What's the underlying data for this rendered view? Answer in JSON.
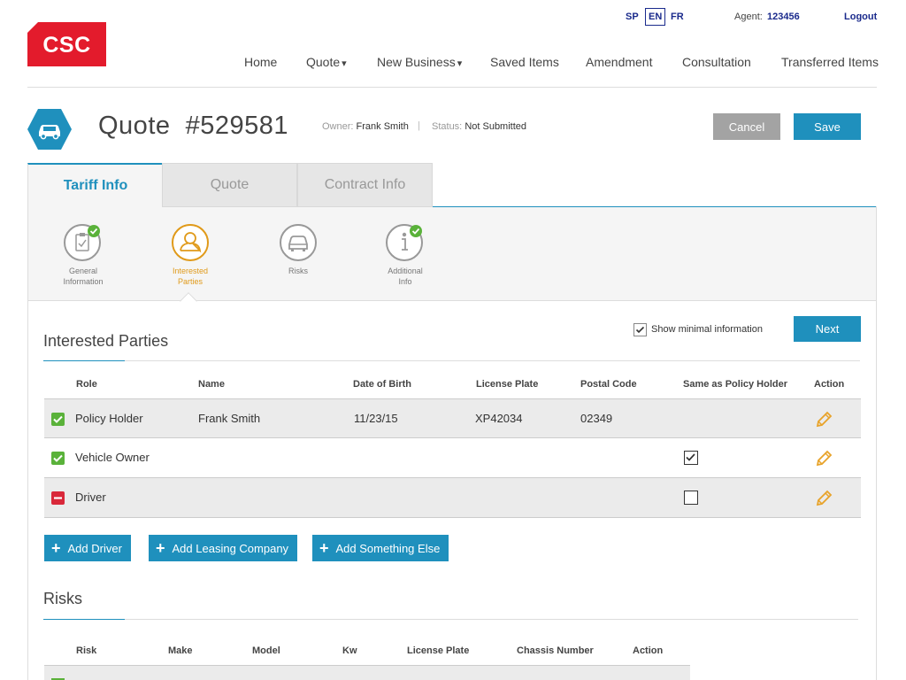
{
  "header": {
    "logo_text": "CSC",
    "languages": [
      "SP",
      "EN",
      "FR"
    ],
    "selected_language": "EN",
    "agent_label": "Agent:",
    "agent_id": "123456",
    "logout": "Logout"
  },
  "nav": {
    "home": "Home",
    "quote": "Quote",
    "new_business": "New Business",
    "saved_items": "Saved Items",
    "amendment": "Amendment",
    "consultation": "Consultation",
    "transferred_items": "Transferred Items",
    "caret": "▾"
  },
  "quote": {
    "title": "Quote",
    "number": "#529581",
    "owner_label": "Owner:",
    "owner": "Frank Smith",
    "separator": "|",
    "status_label": "Status:",
    "status": "Not Submitted",
    "cancel": "Cancel",
    "save": "Save"
  },
  "tabs": [
    {
      "label": "Tariff Info",
      "active": true
    },
    {
      "label": "Quote",
      "active": false
    },
    {
      "label": "Contract Info",
      "active": false
    }
  ],
  "steps": [
    {
      "label_1": "General",
      "label_2": "Information",
      "icon": "clipboard-icon",
      "done": true
    },
    {
      "label_1": "Interested",
      "label_2": "Parties",
      "icon": "person-icon",
      "current": true
    },
    {
      "label_1": "Risks",
      "label_2": "",
      "icon": "car-icon"
    },
    {
      "label_1": "Additional",
      "label_2": "Info",
      "icon": "info-icon",
      "done": true
    }
  ],
  "interested_parties": {
    "title": "Interested Parties",
    "minimal_label": "Show minimal information",
    "minimal_checked": true,
    "next": "Next",
    "columns": [
      "Role",
      "Name",
      "Date of Birth",
      "License Plate",
      "Postal Code",
      "Same as Policy Holder",
      "Action"
    ],
    "rows": [
      {
        "status": "ok",
        "role": "Policy Holder",
        "name": "Frank Smith",
        "dob": "11/23/15",
        "plate": "XP42034",
        "postal": "02349"
      },
      {
        "status": "ok",
        "role": "Vehicle Owner",
        "name": "",
        "dob": "",
        "plate": "",
        "postal": "",
        "same_as": true
      },
      {
        "status": "missing",
        "role": "Driver",
        "name": "",
        "dob": "",
        "plate": "",
        "postal": "",
        "same_as": false
      }
    ],
    "add_driver": "Add Driver",
    "add_leasing": "Add Leasing Company",
    "add_something": "Add Something Else",
    "plus": "+"
  },
  "risks": {
    "title": "Risks",
    "columns": [
      "Risk",
      "Make",
      "Model",
      "Kw",
      "License Plate",
      "Chassis Number",
      "Action"
    ]
  },
  "colors": {
    "brand_red": "#e31b2c",
    "primary_blue": "#1f90bd",
    "current_step": "#e09a1a",
    "ok_green": "#5ab23a",
    "missing_red": "#d9283a",
    "edit_orange": "#e8a32a"
  }
}
